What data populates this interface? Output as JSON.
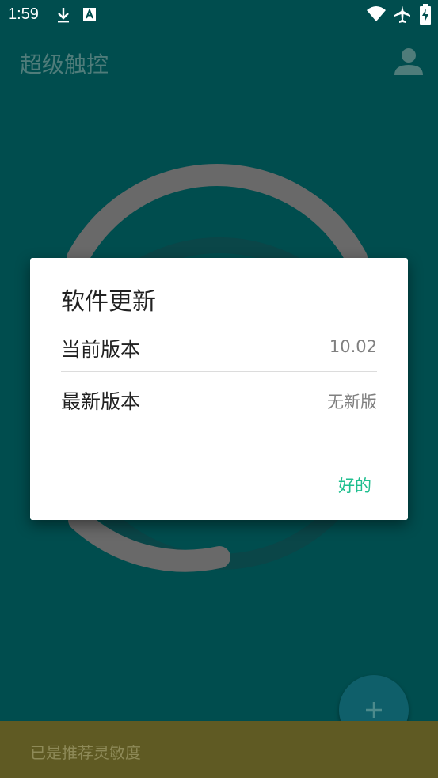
{
  "status_bar": {
    "time": "1:59",
    "icons": [
      "download-icon",
      "a-notification-icon",
      "wifi-icon",
      "airplane-icon",
      "battery-charging-icon"
    ]
  },
  "app_bar": {
    "title": "超级触控",
    "account_icon": "account-icon"
  },
  "dialog": {
    "title": "软件更新",
    "rows": [
      {
        "label": "当前版本",
        "value": "10.02"
      },
      {
        "label": "最新版本",
        "value": "无新版"
      }
    ],
    "ok_label": "好的"
  },
  "fab": {
    "icon": "plus-icon"
  },
  "snackbar": {
    "text": "已是推荐灵敏度"
  },
  "colors": {
    "background": "#004d4e",
    "accent": "#1fbf8f",
    "snackbar": "#5f5a23"
  }
}
